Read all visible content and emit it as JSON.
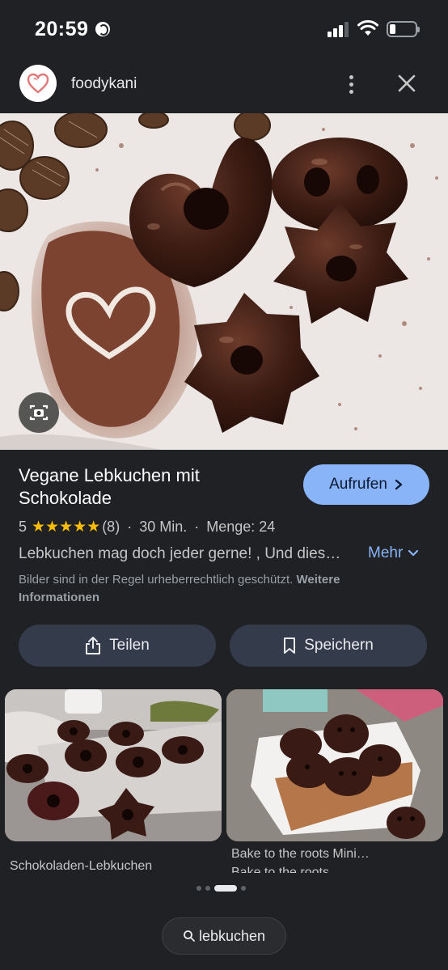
{
  "status_bar": {
    "time": "20:59"
  },
  "header": {
    "source_name": "foodykani"
  },
  "recipe": {
    "title": "Vegane Lebkuchen mit Schokolade",
    "rating_value": "5",
    "stars": "★★★★★",
    "rating": 5,
    "review_count": "(8)",
    "time": "30 Min.",
    "quantity": "Menge: 24",
    "description": "Lebkuchen mag doch jeder gerne! , Und dies…",
    "more_label": "Mehr"
  },
  "open_button": {
    "label": "Aufrufen"
  },
  "copyright": {
    "text": "Bilder sind in der Regel urheberrechtlich geschützt.",
    "link": "Weitere Informationen"
  },
  "actions": {
    "share_label": "Teilen",
    "save_label": "Speichern"
  },
  "related": [
    {
      "title": "Schokoladen-Lebkuchen"
    },
    {
      "title": "Bake to the roots Mini…",
      "source": "Bake to the roots"
    }
  ],
  "search_pill": {
    "query": "lebkuchen"
  },
  "colors": {
    "accent": "#8ab4f8",
    "star": "#fbbc04",
    "background": "#1f2124"
  }
}
